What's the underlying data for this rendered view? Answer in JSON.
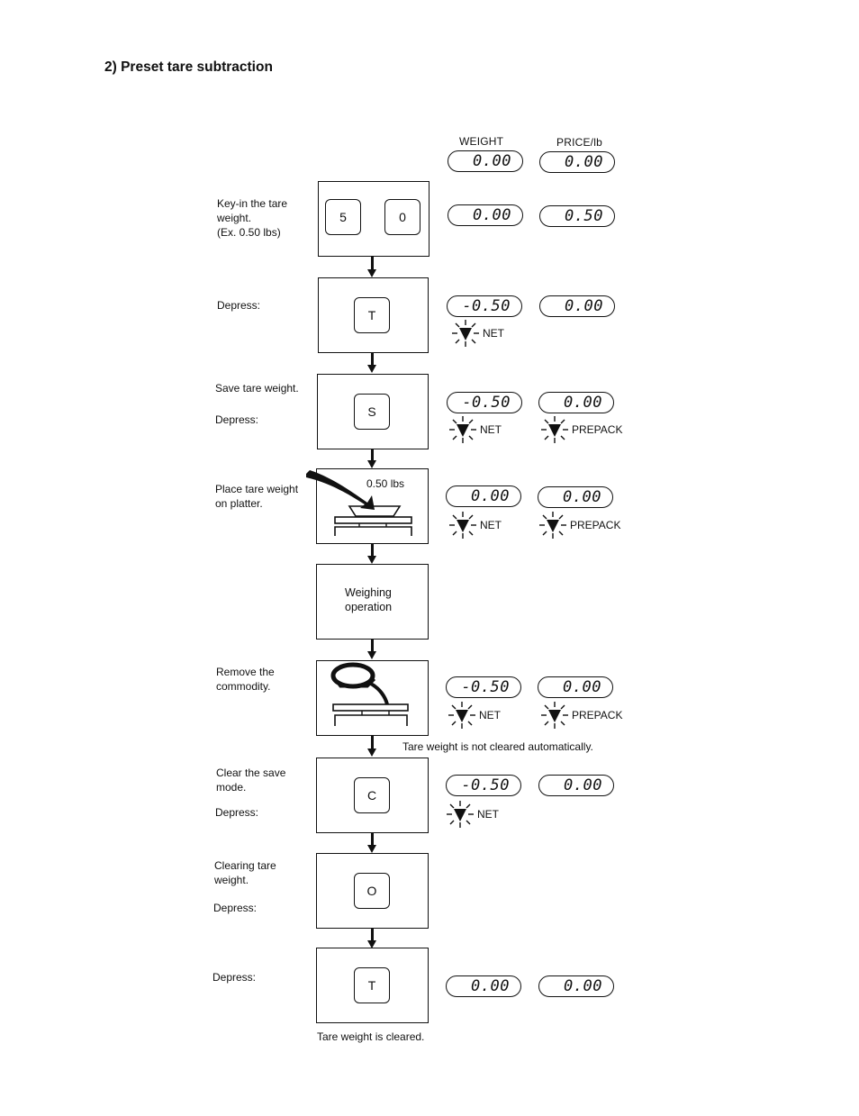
{
  "page": {
    "title": "2) Preset tare subtraction",
    "column_headers": {
      "weight": "WEIGHT",
      "price": "PRICE/lb"
    }
  },
  "initial_display": {
    "weight": "0.00",
    "price": "0.00"
  },
  "steps": [
    {
      "label_lines": [
        "Key-in the tare",
        "weight.",
        "(Ex. 0.50 lbs)"
      ],
      "keys": [
        "5",
        "0"
      ],
      "display": {
        "weight": "0.00",
        "price": "0.50"
      },
      "indicators": []
    },
    {
      "label_lines": [
        "Depress:"
      ],
      "keys": [
        "T"
      ],
      "display": {
        "weight": "-0.50",
        "price": "0.00"
      },
      "indicators": [
        "NET"
      ]
    },
    {
      "label_lines": [
        "Save tare weight.",
        "Depress:"
      ],
      "keys": [
        "S"
      ],
      "display": {
        "weight": "-0.50",
        "price": "0.00"
      },
      "indicators": [
        "NET",
        "PREPACK"
      ]
    },
    {
      "label_lines": [
        "Place tare weight",
        "on platter."
      ],
      "box_caption": "0.50 lbs",
      "illustration": "tray-on-scale",
      "display": {
        "weight": "0.00",
        "price": "0.00"
      },
      "indicators": [
        "NET",
        "PREPACK"
      ]
    },
    {
      "label_lines": [],
      "box_text": [
        "Weighing",
        "operation"
      ]
    },
    {
      "label_lines": [
        "Remove the",
        "commodity."
      ],
      "illustration": "commodity-removed",
      "display": {
        "weight": "-0.50",
        "price": "0.00"
      },
      "indicators": [
        "NET",
        "PREPACK"
      ],
      "note": "Tare weight is not cleared automatically."
    },
    {
      "label_lines": [
        "Clear the save",
        "mode.",
        "Depress:"
      ],
      "keys": [
        "C"
      ],
      "display": {
        "weight": "-0.50",
        "price": "0.00"
      },
      "indicators": [
        "NET"
      ]
    },
    {
      "label_lines": [
        "Clearing tare",
        "weight.",
        "Depress:"
      ],
      "keys": [
        "O"
      ]
    },
    {
      "label_lines": [
        "Depress:"
      ],
      "keys": [
        "T"
      ],
      "display": {
        "weight": "0.00",
        "price": "0.00"
      },
      "note": "Tare weight is cleared."
    }
  ]
}
